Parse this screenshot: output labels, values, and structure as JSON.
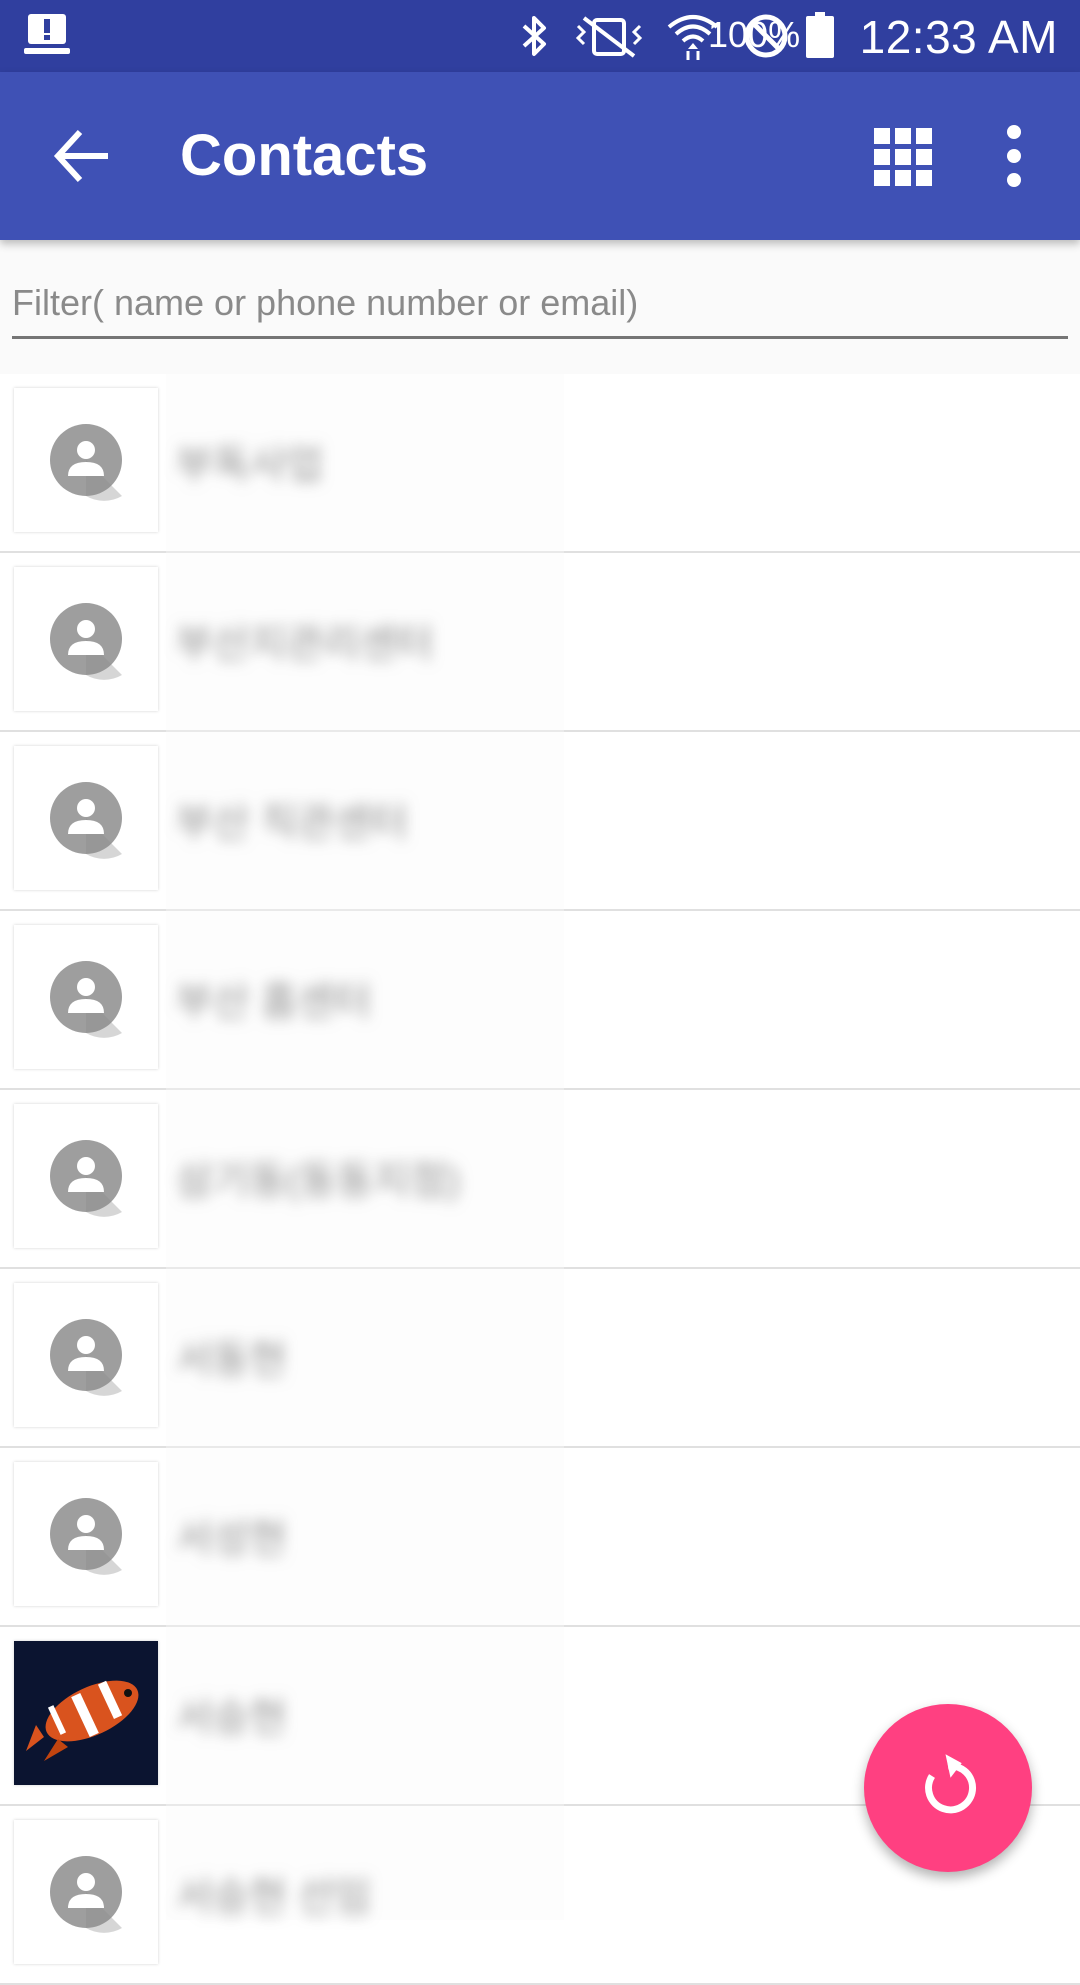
{
  "status_bar": {
    "battery_text": "100%",
    "time": "12:33 AM",
    "icons": [
      "alert-icon",
      "bluetooth-icon",
      "vibrate-off-icon",
      "wifi-icon",
      "do-not-disturb-icon",
      "battery-icon"
    ]
  },
  "app_bar": {
    "title": "Contacts",
    "icons": [
      "back-arrow-icon",
      "grid-view-icon",
      "more-vert-icon"
    ]
  },
  "filter": {
    "placeholder": "Filter( name or phone number or email)",
    "value": ""
  },
  "contacts": [
    {
      "name": "부독사업",
      "avatar": "person-placeholder-icon"
    },
    {
      "name": "부산지관리센터",
      "avatar": "person-placeholder-icon"
    },
    {
      "name": "부산 직관센터",
      "avatar": "person-placeholder-icon"
    },
    {
      "name": "부산 홈센터",
      "avatar": "person-placeholder-icon"
    },
    {
      "name": "삼기동(동동지점)",
      "avatar": "person-placeholder-icon"
    },
    {
      "name": "서동현",
      "avatar": "person-placeholder-icon"
    },
    {
      "name": "서성현",
      "avatar": "person-placeholder-icon"
    },
    {
      "name": "서승현",
      "avatar": "clownfish-photo"
    },
    {
      "name": "서승현 선임",
      "avatar": "person-placeholder-icon"
    }
  ],
  "fab": {
    "icon": "refresh-icon"
  },
  "colors": {
    "status_bar": "#303f9f",
    "app_bar": "#3f51b5",
    "fab": "#ff4081"
  }
}
